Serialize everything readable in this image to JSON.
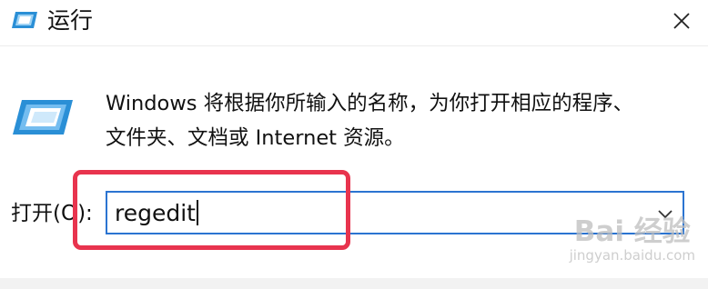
{
  "window": {
    "title": "运行",
    "title_icon": "run-icon",
    "close_icon": "close-icon"
  },
  "description": {
    "line1": "Windows 将根据你所输入的名称，为你打开相应的程序、",
    "line2": "文件夹、文档或 Internet 资源。"
  },
  "open_field": {
    "label": "打开(O):",
    "value": "regedit",
    "dropdown_icon": "chevron-down-icon"
  },
  "annotation": {
    "color": "#e8344e"
  },
  "watermark": {
    "logo": "Bai 经验",
    "url": "jingyan.baidu.com"
  },
  "colors": {
    "focus_border": "#2b74d1",
    "icon_blue": "#2a8fd6"
  }
}
